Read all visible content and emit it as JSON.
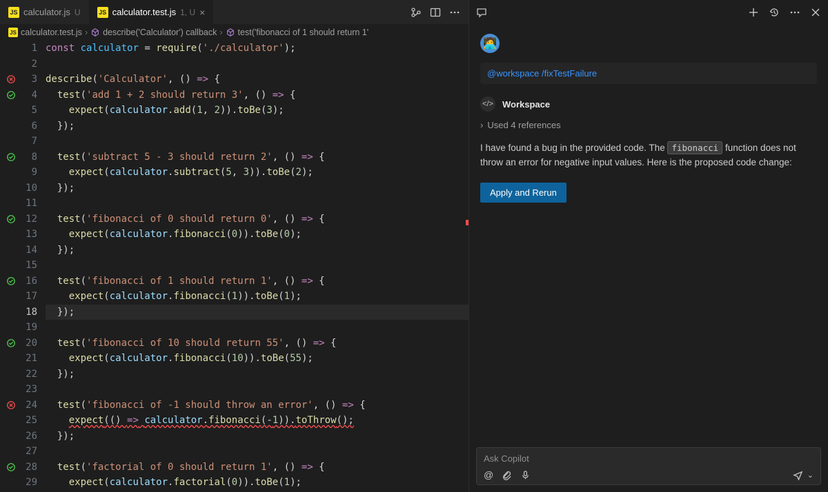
{
  "tabs": [
    {
      "icon": "JS",
      "name": "calculator.js",
      "status": "U",
      "active": false
    },
    {
      "icon": "JS",
      "name": "calculator.test.js",
      "status": "1, U",
      "active": true
    }
  ],
  "breadcrumb": {
    "icon": "JS",
    "file": "calculator.test.js",
    "seg1": "describe('Calculator') callback",
    "seg2": "test('fibonacci of 1 should return 1'"
  },
  "lines": [
    {
      "n": 1,
      "g": "",
      "html": "<span class='t-key'>const</span> <span class='t-var'>calculator</span> <span class='t-op'>=</span> <span class='t-func'>require</span><span class='t-pun'>(</span><span class='t-str'>'./calculator'</span><span class='t-pun'>);</span>"
    },
    {
      "n": 2,
      "g": "",
      "html": ""
    },
    {
      "n": 3,
      "g": "fail",
      "html": "<span class='t-func'>describe</span><span class='t-pun'>(</span><span class='t-str'>'Calculator'</span><span class='t-pun'>, () </span><span class='t-key'>=&gt;</span><span class='t-pun'> {</span>"
    },
    {
      "n": 4,
      "g": "pass",
      "html": "  <span class='t-func'>test</span><span class='t-pun'>(</span><span class='t-str'>'add 1 + 2 should return 3'</span><span class='t-pun'>, () </span><span class='t-key'>=&gt;</span><span class='t-pun'> {</span>"
    },
    {
      "n": 5,
      "g": "",
      "html": "    <span class='t-func'>expect</span><span class='t-pun'>(</span><span class='t-obj'>calculator</span><span class='t-pun'>.</span><span class='t-func'>add</span><span class='t-pun'>(</span><span class='t-num'>1</span><span class='t-pun'>, </span><span class='t-num'>2</span><span class='t-pun'>)).</span><span class='t-func'>toBe</span><span class='t-pun'>(</span><span class='t-num'>3</span><span class='t-pun'>);</span>"
    },
    {
      "n": 6,
      "g": "",
      "html": "  <span class='t-pun'>});</span>"
    },
    {
      "n": 7,
      "g": "",
      "html": ""
    },
    {
      "n": 8,
      "g": "pass",
      "html": "  <span class='t-func'>test</span><span class='t-pun'>(</span><span class='t-str'>'subtract 5 - 3 should return 2'</span><span class='t-pun'>, () </span><span class='t-key'>=&gt;</span><span class='t-pun'> {</span>"
    },
    {
      "n": 9,
      "g": "",
      "html": "    <span class='t-func'>expect</span><span class='t-pun'>(</span><span class='t-obj'>calculator</span><span class='t-pun'>.</span><span class='t-func'>subtract</span><span class='t-pun'>(</span><span class='t-num'>5</span><span class='t-pun'>, </span><span class='t-num'>3</span><span class='t-pun'>)).</span><span class='t-func'>toBe</span><span class='t-pun'>(</span><span class='t-num'>2</span><span class='t-pun'>);</span>"
    },
    {
      "n": 10,
      "g": "",
      "html": "  <span class='t-pun'>});</span>"
    },
    {
      "n": 11,
      "g": "",
      "html": ""
    },
    {
      "n": 12,
      "g": "pass",
      "html": "  <span class='t-func'>test</span><span class='t-pun'>(</span><span class='t-str'>'fibonacci of 0 should return 0'</span><span class='t-pun'>, () </span><span class='t-key'>=&gt;</span><span class='t-pun'> {</span>"
    },
    {
      "n": 13,
      "g": "",
      "html": "    <span class='t-func'>expect</span><span class='t-pun'>(</span><span class='t-obj'>calculator</span><span class='t-pun'>.</span><span class='t-func'>fibonacci</span><span class='t-pun'>(</span><span class='t-num'>0</span><span class='t-pun'>)).</span><span class='t-func'>toBe</span><span class='t-pun'>(</span><span class='t-num'>0</span><span class='t-pun'>);</span>"
    },
    {
      "n": 14,
      "g": "",
      "html": "  <span class='t-pun'>});</span>"
    },
    {
      "n": 15,
      "g": "",
      "html": ""
    },
    {
      "n": 16,
      "g": "pass",
      "html": "  <span class='t-func'>test</span><span class='t-pun'>(</span><span class='t-str'>'fibonacci of 1 should return 1'</span><span class='t-pun'>, () </span><span class='t-key'>=&gt;</span><span class='t-pun'> {</span>"
    },
    {
      "n": 17,
      "g": "",
      "html": "    <span class='t-func'>expect</span><span class='t-pun'>(</span><span class='t-obj'>calculator</span><span class='t-pun'>.</span><span class='t-func'>fibonacci</span><span class='t-pun'>(</span><span class='t-num'>1</span><span class='t-pun'>)).</span><span class='t-func'>toBe</span><span class='t-pun'>(</span><span class='t-num'>1</span><span class='t-pun'>);</span>"
    },
    {
      "n": 18,
      "g": "",
      "html": "  <span class='t-pun'>});</span>",
      "current": true
    },
    {
      "n": 19,
      "g": "",
      "html": ""
    },
    {
      "n": 20,
      "g": "pass",
      "html": "  <span class='t-func'>test</span><span class='t-pun'>(</span><span class='t-str'>'fibonacci of 10 should return 55'</span><span class='t-pun'>, () </span><span class='t-key'>=&gt;</span><span class='t-pun'> {</span>"
    },
    {
      "n": 21,
      "g": "",
      "html": "    <span class='t-func'>expect</span><span class='t-pun'>(</span><span class='t-obj'>calculator</span><span class='t-pun'>.</span><span class='t-func'>fibonacci</span><span class='t-pun'>(</span><span class='t-num'>10</span><span class='t-pun'>)).</span><span class='t-func'>toBe</span><span class='t-pun'>(</span><span class='t-num'>55</span><span class='t-pun'>);</span>"
    },
    {
      "n": 22,
      "g": "",
      "html": "  <span class='t-pun'>});</span>"
    },
    {
      "n": 23,
      "g": "",
      "html": ""
    },
    {
      "n": 24,
      "g": "fail",
      "html": "  <span class='t-func'>test</span><span class='t-pun'>(</span><span class='t-str'>'fibonacci of -1 should throw an error'</span><span class='t-pun'>, () </span><span class='t-key'>=&gt;</span><span class='t-pun'> {</span>"
    },
    {
      "n": 25,
      "g": "",
      "html": "    <span class='t-err'><span class='t-func'>expect</span><span class='t-pun'>(() </span><span class='t-key'>=&gt;</span><span class='t-pun'> </span><span class='t-obj'>calculator</span><span class='t-pun'>.</span><span class='t-func'>fibonacci</span><span class='t-pun'>(-</span><span class='t-num'>1</span><span class='t-pun'>)).</span><span class='t-func'>toThrow</span><span class='t-pun'>();</span></span>"
    },
    {
      "n": 26,
      "g": "",
      "html": "  <span class='t-pun'>});</span>"
    },
    {
      "n": 27,
      "g": "",
      "html": ""
    },
    {
      "n": 28,
      "g": "pass",
      "html": "  <span class='t-func'>test</span><span class='t-pun'>(</span><span class='t-str'>'factorial of 0 should return 1'</span><span class='t-pun'>, () </span><span class='t-key'>=&gt;</span><span class='t-pun'> {</span>"
    },
    {
      "n": 29,
      "g": "",
      "html": "    <span class='t-func'>expect</span><span class='t-pun'>(</span><span class='t-obj'>calculator</span><span class='t-pun'>.</span><span class='t-func'>factorial</span><span class='t-pun'>(</span><span class='t-num'>0</span><span class='t-pun'>)).</span><span class='t-func'>toBe</span><span class='t-pun'>(</span><span class='t-num'>1</span><span class='t-pun'>);</span>"
    }
  ],
  "chat": {
    "cmd_ws": "@workspace",
    "cmd_slash": "/fixTestFailure",
    "ws_name": "Workspace",
    "refs": "Used 4 references",
    "msg_pre": "I have found a bug in the provided code. The ",
    "msg_code": "fibonacci",
    "msg_post": " function does not throw an error for negative input values. Here is the proposed code change:",
    "apply": "Apply and Rerun",
    "placeholder": "Ask Copilot"
  }
}
